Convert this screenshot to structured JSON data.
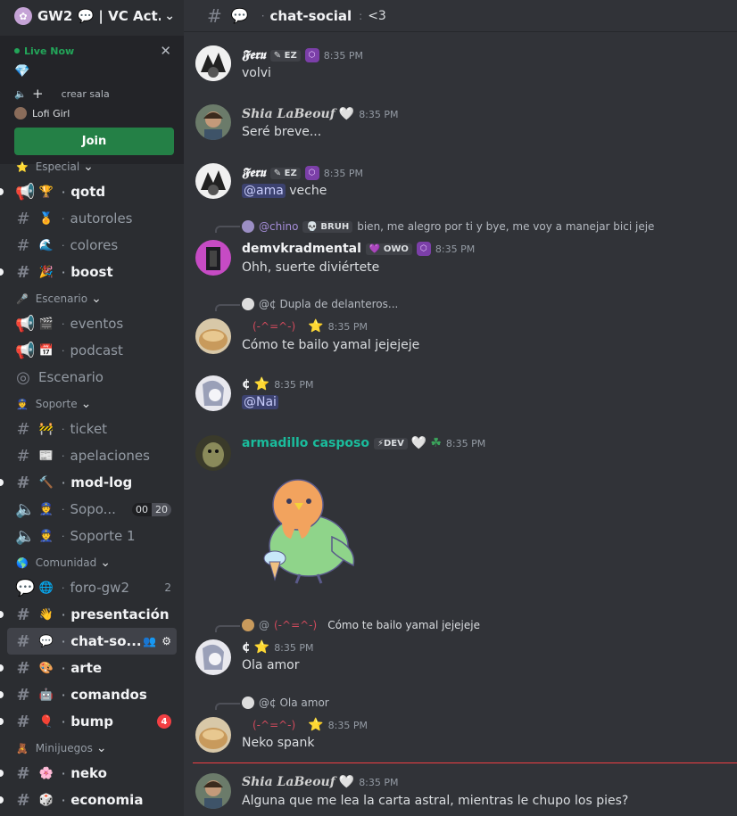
{
  "server": {
    "name": "GW2 💬 | VC Act..."
  },
  "live": {
    "title": "Live Now",
    "gem": "💎",
    "action": "crear sala",
    "user": "Lofi Girl",
    "join_label": "Join"
  },
  "categories": {
    "especial": "Especial",
    "escenario": "Escenario",
    "soporte": "Soporte",
    "comunidad": "Comunidad",
    "minijuegos": "Minijuegos"
  },
  "channels": {
    "qotd": "qotd",
    "autoroles": "autoroles",
    "colores": "colores",
    "boost": "boost",
    "eventos": "eventos",
    "podcast": "podcast",
    "escenario": "Escenario",
    "ticket": "ticket",
    "apelaciones": "apelaciones",
    "modlog": "mod-log",
    "sopo": "Sopo...",
    "sopo_count_a": "00",
    "sopo_count_b": "20",
    "soporte1": "Soporte 1",
    "forogw2": "foro-gw2",
    "forogw2_count": "2",
    "presentacion": "presentación",
    "chatso": "chat-so...",
    "arte": "arte",
    "comandos": "comandos",
    "bump": "bump",
    "bump_badge": "4",
    "neko": "neko",
    "economia": "economia"
  },
  "topbar": {
    "title": "chat-social",
    "topic": "<3"
  },
  "messages": [
    {
      "user": "𝕱𝖊𝖗𝖚",
      "tag": "EZ",
      "time": "8:35 PM",
      "text": "volvi"
    },
    {
      "user": "𝑺𝒉𝒊𝒂 𝑳𝒂𝑩𝒆𝒐𝒖𝒇",
      "time": "8:35 PM",
      "text": "Seré breve..."
    },
    {
      "user": "𝕱𝖊𝖗𝖚",
      "tag": "EZ",
      "time": "8:35 PM",
      "mention": "@ama",
      "text": " veche"
    },
    {
      "reply_user": "@chino",
      "reply_tag": "BRUH",
      "reply_text": "bien, me alegro por ti y bye, me voy a manejar bici jeje",
      "user": "demvkradmental",
      "tag": "OWO",
      "time": "8:35 PM",
      "text": "Ohh, suerte diviértete"
    },
    {
      "reply_text": "@¢ Dupla de delanteros...",
      "user": "(-^=^-)",
      "time": "8:35 PM",
      "text": "Cómo te bailo yamal jejejeje"
    },
    {
      "user": "¢",
      "time": "8:35 PM",
      "mention": "@Nai"
    },
    {
      "user": "armadillo casposo",
      "tag": "DEV",
      "time": "8:35 PM"
    },
    {
      "reply_user": "@",
      "reply_kao": "(-^=^-)",
      "reply_text": "Cómo te bailo yamal jejejeje",
      "user": "¢",
      "time": "8:35 PM",
      "text": "Ola amor"
    },
    {
      "reply_text": "@¢ Ola amor",
      "user": "(-^=^-)",
      "time": "8:35 PM",
      "text": "Neko spank"
    },
    {
      "user": "𝑺𝒉𝒊𝒂 𝑳𝒂𝑩𝒆𝒐𝒖𝒇",
      "time": "8:35 PM",
      "text": "Alguna que me lea la carta astral, mientras le chupo los pies?"
    }
  ],
  "colors": {
    "accent": "#248046",
    "mention_bg": "#3c4270",
    "teal_name": "#1abc9c",
    "unread_line": "#f23f43"
  }
}
